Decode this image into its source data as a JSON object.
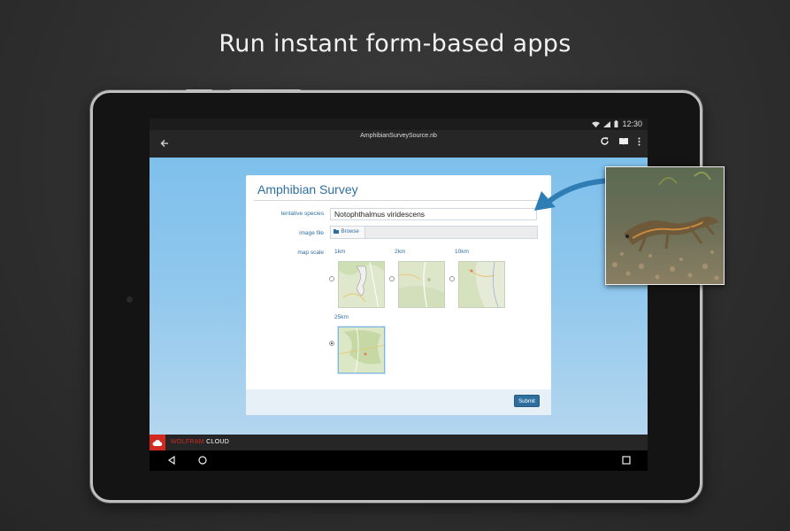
{
  "headline": "Run instant form-based apps",
  "status_bar": {
    "time": "12:30"
  },
  "app_bar": {
    "title": "AmphibianSurveySource.nb"
  },
  "form": {
    "title": "Amphibian Survey",
    "species_label": "tentative species",
    "species_value": "Notophthalmus viridescens",
    "image_label": "image file",
    "browse_label": "Browse",
    "map_scale_label": "map scale",
    "map_options": [
      "1km",
      "2km",
      "10km",
      "25km"
    ],
    "map_selected": "25km",
    "submit_label": "Submit"
  },
  "brand": {
    "part1": "WOLFRAM",
    "part2": "CLOUD",
    "color1": "#d3281f",
    "color2": "#ffffff"
  },
  "colors": {
    "accent": "#2f6fa0",
    "background": "#2e2e2e"
  }
}
